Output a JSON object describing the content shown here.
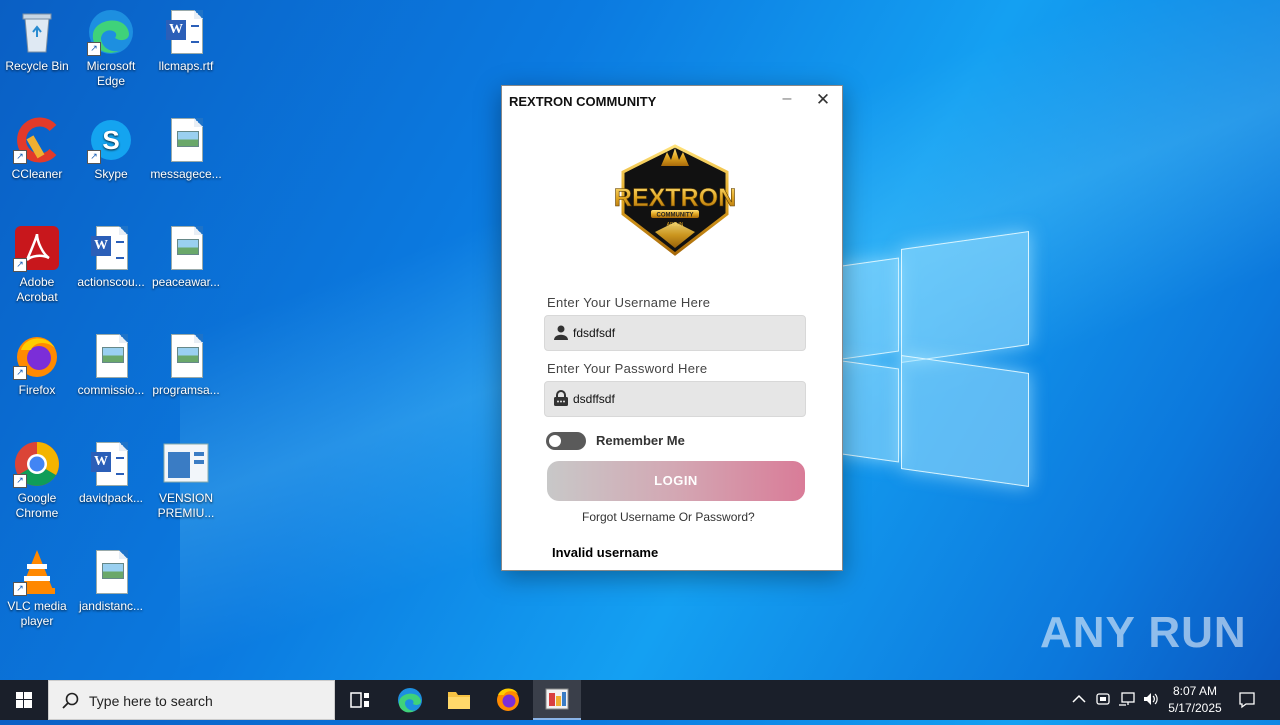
{
  "desktop": {
    "icons": [
      {
        "label": "Recycle Bin"
      },
      {
        "label": "Microsoft Edge"
      },
      {
        "label": "llcmaps.rtf"
      },
      {
        "label": "CCleaner"
      },
      {
        "label": "Skype"
      },
      {
        "label": "messagece..."
      },
      {
        "label": "Adobe Acrobat"
      },
      {
        "label": "actionscou..."
      },
      {
        "label": "peaceawar..."
      },
      {
        "label": "Firefox"
      },
      {
        "label": "commissio..."
      },
      {
        "label": "programsa..."
      },
      {
        "label": "Google Chrome"
      },
      {
        "label": "davidpack..."
      },
      {
        "label": "VENSION PREMIU..."
      },
      {
        "label": "VLC media player"
      },
      {
        "label": "jandistanc..."
      }
    ]
  },
  "login_window": {
    "title": "REXTRON COMMUNITY",
    "logo_text": "REXTRON",
    "logo_sub": "COMMUNITY",
    "logo_sub2": "ARJUN",
    "username_label": "Enter Your Username Here",
    "username_value": "fdsdfsdf",
    "password_label": "Enter Your Password Here",
    "password_value": "dsdffsdf",
    "remember_label": "Remember Me",
    "remember_on": false,
    "login_label": "LOGIN",
    "forgot_label": "Forgot Username Or Password?",
    "error_text": "Invalid username"
  },
  "watermark": "ANY RUN",
  "taskbar": {
    "search_placeholder": "Type here to search",
    "time": "8:07 AM",
    "date": "5/17/2025"
  }
}
